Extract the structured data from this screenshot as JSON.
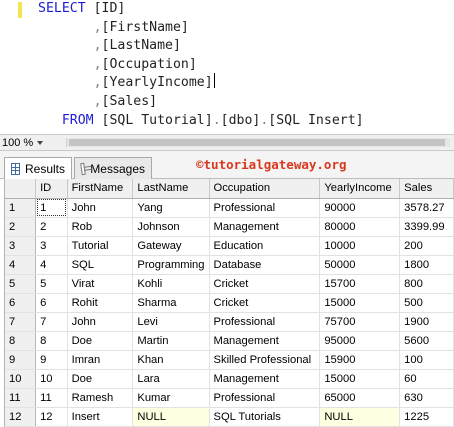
{
  "editor": {
    "lines": [
      {
        "indent": "",
        "tokens": [
          {
            "t": "SELECT",
            "c": "kw"
          },
          {
            "t": " [ID]",
            "c": "br"
          }
        ]
      },
      {
        "indent": "       ",
        "tokens": [
          {
            "t": ",",
            "c": "cm"
          },
          {
            "t": "[FirstName]",
            "c": "br"
          }
        ]
      },
      {
        "indent": "       ",
        "tokens": [
          {
            "t": ",",
            "c": "cm"
          },
          {
            "t": "[LastName]",
            "c": "br"
          }
        ]
      },
      {
        "indent": "       ",
        "tokens": [
          {
            "t": ",",
            "c": "cm"
          },
          {
            "t": "[Occupation]",
            "c": "br"
          }
        ]
      },
      {
        "indent": "       ",
        "tokens": [
          {
            "t": ",",
            "c": "cm"
          },
          {
            "t": "[YearlyIncome]",
            "c": "br"
          }
        ],
        "caret": true
      },
      {
        "indent": "       ",
        "tokens": [
          {
            "t": ",",
            "c": "cm"
          },
          {
            "t": "[Sales]",
            "c": "br"
          }
        ]
      },
      {
        "indent": "   ",
        "tokens": [
          {
            "t": "FROM",
            "c": "kw"
          },
          {
            "t": " [SQL Tutorial]",
            "c": "br"
          },
          {
            "t": ".",
            "c": "cm"
          },
          {
            "t": "[dbo]",
            "c": "br"
          },
          {
            "t": ".",
            "c": "cm"
          },
          {
            "t": "[SQL Insert]",
            "c": "br"
          }
        ]
      }
    ]
  },
  "zoom": {
    "value": "100 %"
  },
  "results": {
    "tabs": [
      {
        "label": "Results",
        "icon": "grid-icon",
        "active": true
      },
      {
        "label": "Messages",
        "icon": "messages-icon",
        "active": false
      }
    ],
    "watermark": "©tutorialgateway.org",
    "columns": [
      "ID",
      "FirstName",
      "LastName",
      "Occupation",
      "YearlyIncome",
      "Sales"
    ],
    "rows": [
      [
        "1",
        "John",
        "Yang",
        "Professional",
        "90000",
        "3578.27"
      ],
      [
        "2",
        "Rob",
        "Johnson",
        "Management",
        "80000",
        "3399.99"
      ],
      [
        "3",
        "Tutorial",
        "Gateway",
        "Education",
        "10000",
        "200"
      ],
      [
        "4",
        "SQL",
        "Programming",
        "Database",
        "50000",
        "1800"
      ],
      [
        "5",
        "Virat",
        "Kohli",
        "Cricket",
        "15700",
        "800"
      ],
      [
        "6",
        "Rohit",
        "Sharma",
        "Cricket",
        "15000",
        "500"
      ],
      [
        "7",
        "John",
        "Levi",
        "Professional",
        "75700",
        "1900"
      ],
      [
        "8",
        "Doe",
        "Martin",
        "Management",
        "95000",
        "5600"
      ],
      [
        "9",
        "Imran",
        "Khan",
        "Skilled Professional",
        "15900",
        "100"
      ],
      [
        "10",
        "Doe",
        "Lara",
        "Management",
        "15000",
        "60"
      ],
      [
        "11",
        "Ramesh",
        "Kumar",
        "Professional",
        "65000",
        "630"
      ],
      [
        "12",
        "Insert",
        "NULL",
        "SQL Tutorials",
        "NULL",
        "1225"
      ]
    ],
    "null_text": "NULL",
    "colors": {
      "keyword": "#1d1dd6",
      "watermark": "#d9381e",
      "null_cell": "#ffffe1"
    }
  }
}
